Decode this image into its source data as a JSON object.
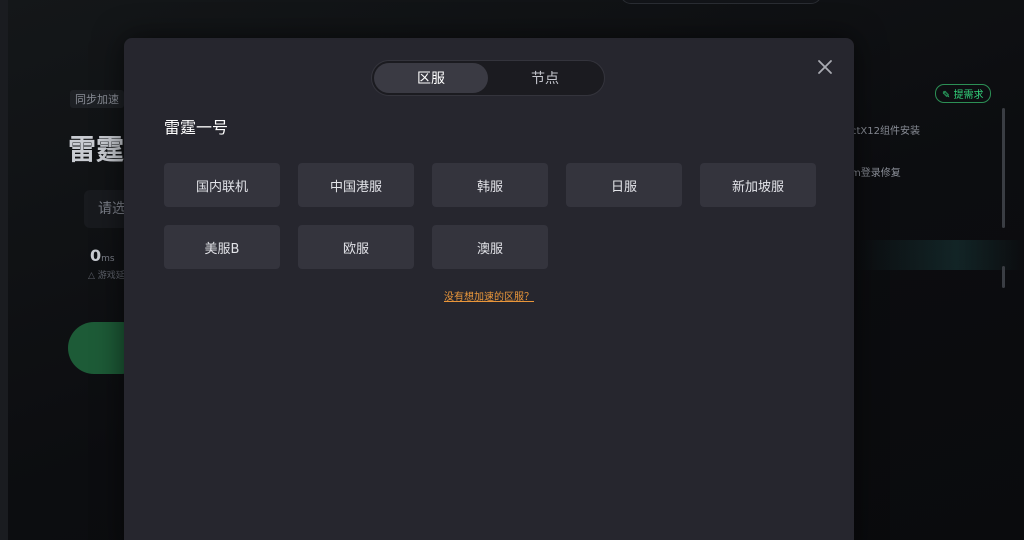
{
  "background": {
    "tag": "同步加速",
    "title": "雷霆",
    "select_placeholder": "请选",
    "ping_value": "0",
    "ping_unit": "ms",
    "ping_sub": "△ 游戏延",
    "feedback_pill": "提需求",
    "right_line1": "ctX12组件安装",
    "right_line2": "m登录修复"
  },
  "modal": {
    "tabs": [
      {
        "label": "区服",
        "active": true
      },
      {
        "label": "节点",
        "active": false
      }
    ],
    "close_icon": "close-icon",
    "game_title": "雷霆一号",
    "regions": [
      "国内联机",
      "中国港服",
      "韩服",
      "日服",
      "新加坡服",
      "美服B",
      "欧服",
      "澳服"
    ],
    "missing_link": "没有想加速的区服？"
  },
  "colors": {
    "modal_bg": "#26262e",
    "region_bg": "#34343d",
    "link": "#e9963a",
    "accent_green": "#33d17a"
  }
}
